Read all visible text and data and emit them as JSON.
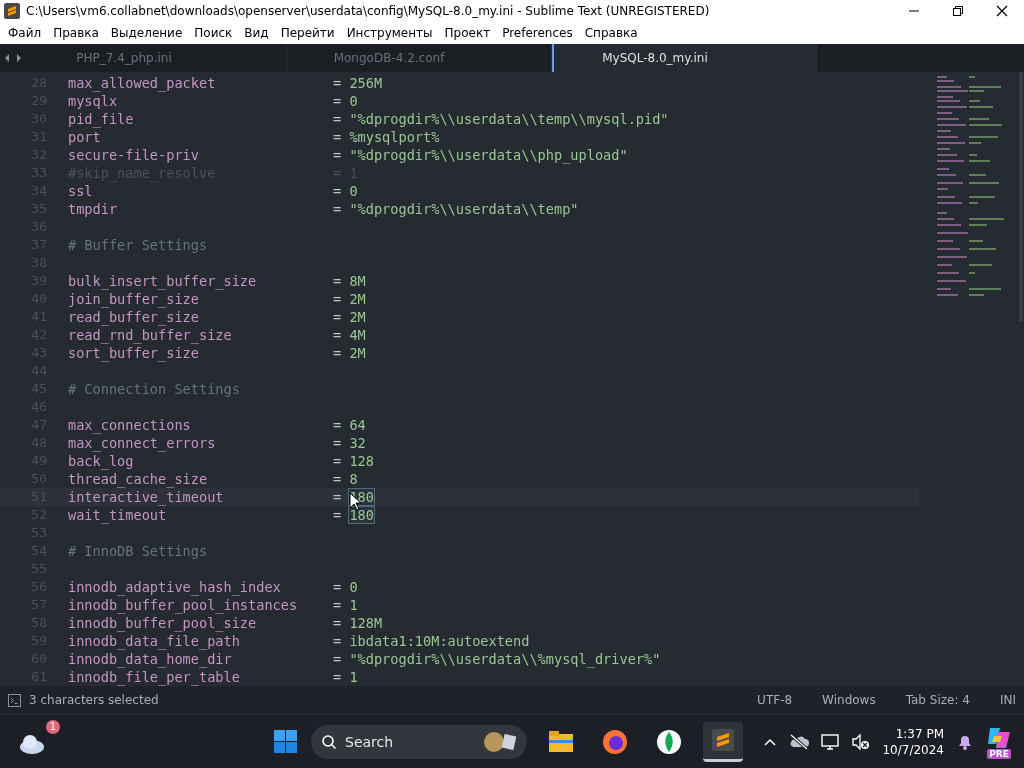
{
  "window": {
    "title": "C:\\Users\\vm6.collabnet\\downloads\\openserver\\userdata\\config\\MySQL-8.0_my.ini - Sublime Text (UNREGISTERED)"
  },
  "menu": [
    "Файл",
    "Правка",
    "Выделение",
    "Поиск",
    "Вид",
    "Перейти",
    "Инструменты",
    "Проект",
    "Preferences",
    "Справка"
  ],
  "tabs": [
    {
      "label": "PHP_7.4_php.ini",
      "selected": false
    },
    {
      "label": "MongoDB-4.2.conf",
      "selected": false
    },
    {
      "label": "MySQL-8.0_my.ini",
      "selected": true
    }
  ],
  "editor": {
    "lines": [
      {
        "number": "28",
        "kind": "setting",
        "key": "max_allowed_packet",
        "sep": "=",
        "value": "256M"
      },
      {
        "number": "29",
        "kind": "setting",
        "key": "mysqlx",
        "sep": "=",
        "value": "0"
      },
      {
        "number": "30",
        "kind": "setting",
        "key": "pid_file",
        "sep": "=",
        "value": "\"%dprogdir%\\\\userdata\\\\temp\\\\mysql.pid\""
      },
      {
        "number": "31",
        "kind": "setting",
        "key": "port",
        "sep": "=",
        "value": "%mysqlport%"
      },
      {
        "number": "32",
        "kind": "setting",
        "key": "secure-file-priv",
        "sep": "=",
        "value": "\"%dprogdir%\\\\userdata\\\\php_upload\""
      },
      {
        "number": "33",
        "kind": "disabled",
        "key": "#skip_name_resolve",
        "sep": "=",
        "value": "1"
      },
      {
        "number": "34",
        "kind": "setting",
        "key": "ssl",
        "sep": "=",
        "value": "0"
      },
      {
        "number": "35",
        "kind": "setting",
        "key": "tmpdir",
        "sep": "=",
        "value": "\"%dprogdir%\\\\userdata\\\\temp\""
      },
      {
        "number": "36",
        "kind": "blank"
      },
      {
        "number": "37",
        "kind": "comment",
        "text": "# Buffer Settings"
      },
      {
        "number": "38",
        "kind": "blank"
      },
      {
        "number": "39",
        "kind": "setting",
        "key": "bulk_insert_buffer_size",
        "sep": "=",
        "value": "8M"
      },
      {
        "number": "40",
        "kind": "setting",
        "key": "join_buffer_size",
        "sep": "=",
        "value": "2M"
      },
      {
        "number": "41",
        "kind": "setting",
        "key": "read_buffer_size",
        "sep": "=",
        "value": "2M"
      },
      {
        "number": "42",
        "kind": "setting",
        "key": "read_rnd_buffer_size",
        "sep": "=",
        "value": "4M"
      },
      {
        "number": "43",
        "kind": "setting",
        "key": "sort_buffer_size",
        "sep": "=",
        "value": "2M"
      },
      {
        "number": "44",
        "kind": "blank"
      },
      {
        "number": "45",
        "kind": "comment",
        "text": "# Connection Settings"
      },
      {
        "number": "46",
        "kind": "blank"
      },
      {
        "number": "47",
        "kind": "setting",
        "key": "max_connections",
        "sep": "=",
        "value": "64"
      },
      {
        "number": "48",
        "kind": "setting",
        "key": "max_connect_errors",
        "sep": "=",
        "value": "32"
      },
      {
        "number": "49",
        "kind": "setting",
        "key": "back_log",
        "sep": "=",
        "value": "128"
      },
      {
        "number": "50",
        "kind": "setting",
        "key": "thread_cache_size",
        "sep": "=",
        "value": "8"
      },
      {
        "number": "51",
        "kind": "setting",
        "key": "interactive_timeout",
        "sep": "=",
        "value": "180",
        "selected": true,
        "current": true
      },
      {
        "number": "52",
        "kind": "setting",
        "key": "wait_timeout",
        "sep": "=",
        "value": "180",
        "selected": true
      },
      {
        "number": "53",
        "kind": "blank"
      },
      {
        "number": "54",
        "kind": "comment",
        "text": "# InnoDB Settings"
      },
      {
        "number": "55",
        "kind": "blank"
      },
      {
        "number": "56",
        "kind": "setting",
        "key": "innodb_adaptive_hash_index",
        "sep": "=",
        "value": "0"
      },
      {
        "number": "57",
        "kind": "setting",
        "key": "innodb_buffer_pool_instances",
        "sep": "=",
        "value": "1"
      },
      {
        "number": "58",
        "kind": "setting",
        "key": "innodb_buffer_pool_size",
        "sep": "=",
        "value": "128M"
      },
      {
        "number": "59",
        "kind": "setting",
        "key": "innodb_data_file_path",
        "sep": "=",
        "value": "ibdata1:10M:autoextend"
      },
      {
        "number": "60",
        "kind": "setting",
        "key": "innodb_data_home_dir",
        "sep": "=",
        "value": "\"%dprogdir%\\\\userdata\\\\%mysql_driver%\""
      },
      {
        "number": "61",
        "kind": "setting",
        "key": "innodb_file_per_table",
        "sep": "=",
        "value": "1"
      }
    ]
  },
  "status_bar": {
    "message": "3 characters selected",
    "encoding": "UTF-8",
    "line_endings": "Windows",
    "tab_size": "Tab Size: 4",
    "syntax": "INI"
  },
  "taskbar": {
    "weather_badge": "1",
    "search_placeholder": "Search",
    "time": "1:37 PM",
    "date": "10/7/2024",
    "copilot_badge": "PRE"
  }
}
